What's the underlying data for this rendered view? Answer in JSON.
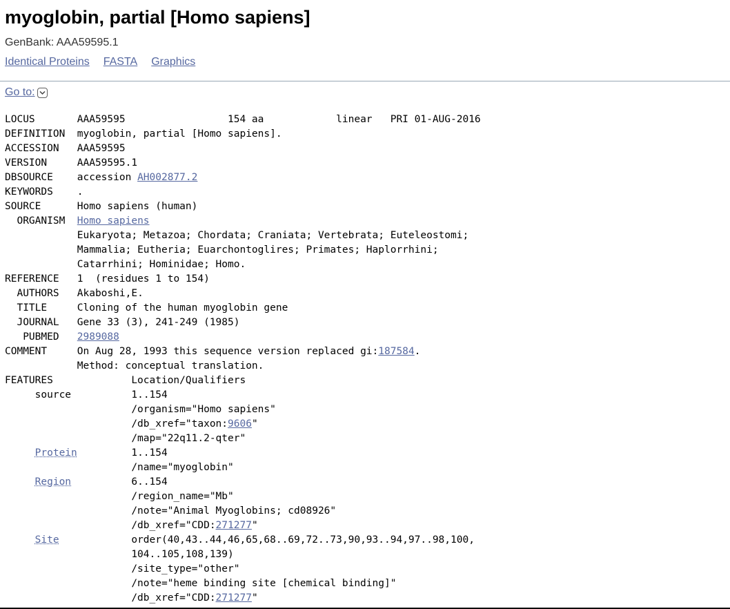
{
  "header": {
    "title": "myoglobin, partial [Homo sapiens]",
    "genbank_label": "GenBank: AAA59595.1",
    "links": [
      "Identical Proteins",
      "FASTA",
      "Graphics"
    ],
    "goto_label": "Go to:"
  },
  "record": {
    "locus_line": "AAA59595                 154 aa            linear   PRI 01-AUG-2016",
    "definition": "myoglobin, partial [Homo sapiens].",
    "accession": "AAA59595",
    "version": "AAA59595.1",
    "dbsource_prefix": "accession ",
    "dbsource_link": "AH002877.2",
    "keywords": ".",
    "source": "Homo sapiens (human)",
    "organism_link": "Homo sapiens",
    "lineage": [
      "Eukaryota; Metazoa; Chordata; Craniata; Vertebrata; Euteleostomi;",
      "Mammalia; Eutheria; Euarchontoglires; Primates; Haplorrhini;",
      "Catarrhini; Hominidae; Homo."
    ],
    "reference": "1  (residues 1 to 154)",
    "authors": "Akaboshi,E.",
    "ref_title": "Cloning of the human myoglobin gene",
    "journal": "Gene 33 (3), 241-249 (1985)",
    "pubmed_link": "2989088",
    "comment_prefix": "On Aug 28, 1993 this sequence version replaced gi:",
    "comment_link": "187584",
    "comment_suffix": ".",
    "comment_line2": "Method: conceptual translation.",
    "features_header": "Location/Qualifiers",
    "source_feature": {
      "key": "source",
      "location": "1..154",
      "organism": "/organism=\"Homo sapiens\"",
      "xref_prefix": "/db_xref=\"taxon:",
      "xref_link": "9606",
      "xref_suffix": "\"",
      "map": "/map=\"22q11.2-qter\""
    },
    "protein_feature": {
      "key": "Protein",
      "location": "1..154",
      "name": "/name=\"myoglobin\""
    },
    "region_feature": {
      "key": "Region",
      "location": "6..154",
      "region_name": "/region_name=\"Mb\"",
      "note": "/note=\"Animal Myoglobins; cd08926\"",
      "xref_prefix": "/db_xref=\"CDD:",
      "xref_link": "271277",
      "xref_suffix": "\""
    },
    "site_feature": {
      "key": "Site",
      "location_line1": "order(40,43..44,46,65,68..69,72..73,90,93..94,97..98,100,",
      "location_line2": "104..105,108,139)",
      "site_type": "/site_type=\"other\"",
      "note": "/note=\"heme binding site [chemical binding]\"",
      "xref_prefix": "/db_xref=\"CDD:",
      "xref_link": "271277",
      "xref_suffix": "\""
    }
  }
}
